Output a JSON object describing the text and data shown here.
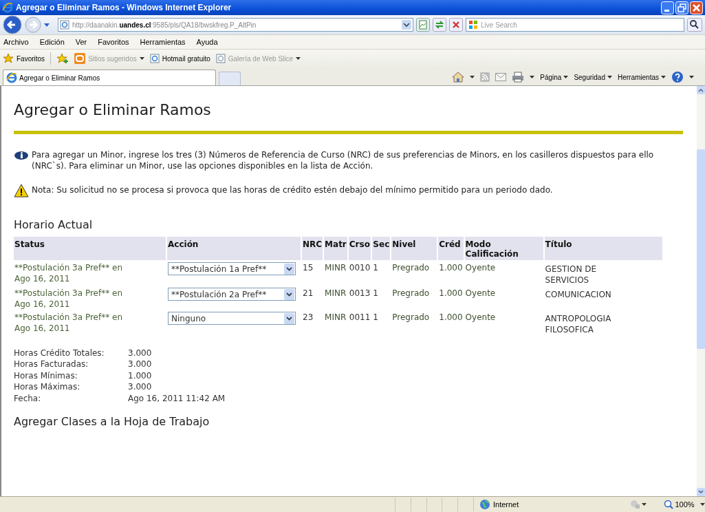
{
  "window": {
    "title": "Agregar o Eliminar Ramos - Windows Internet Explorer"
  },
  "address_bar": {
    "url_prefix": "http://daanakin.",
    "url_domain": "uandes.cl",
    "url_rest": ":9585/pls/QA18/bwskfreg.P_AltPin",
    "search_placeholder": "Live Search"
  },
  "menu": [
    "Archivo",
    "Edición",
    "Ver",
    "Favoritos",
    "Herramientas",
    "Ayuda"
  ],
  "favorites_bar": {
    "label": "Favoritos",
    "items": [
      {
        "label": "Sitios sugeridos",
        "kind": "feed",
        "disabled": true,
        "dropdown": true
      },
      {
        "label": "Hotmail gratuito",
        "kind": "page",
        "disabled": false,
        "dropdown": false
      },
      {
        "label": "Galería de Web Slice",
        "kind": "page",
        "disabled": true,
        "dropdown": true
      }
    ]
  },
  "tab": {
    "title": "Agregar o Eliminar Ramos"
  },
  "command_bar": [
    "Página",
    "Seguridad",
    "Herramientas"
  ],
  "page": {
    "title": "Agregar o Eliminar Ramos",
    "info": "Para agregar un Minor, ingrese los tres (3) Números de Referencia de Curso (NRC) de sus preferencias de Minors, en los casilleros dispuestos para ello (NRC`s). Para eliminar un Minor, use las opciones disponibles en la lista de Acción.",
    "note": "Nota: Su solicitud no se procesa si provoca que las horas de crédito estén debajo del mínimo permitido para un periodo dado.",
    "section": "Horario Actual",
    "table": {
      "columns": [
        "Status",
        "Acción",
        "NRC",
        "Matr",
        "Crso",
        "Sec",
        "Nivel",
        "Créd",
        "Modo Calificación",
        "Título"
      ],
      "rows": [
        {
          "status": "**Postulación 3a Pref** en Ago 16, 2011",
          "action": "**Postulación 1a Pref**",
          "nrc": "15",
          "matr": "MINR",
          "crso": "0010",
          "sec": "1",
          "nivel": "Pregrado",
          "cred": "1.000",
          "modo": "Oyente",
          "titulo": "GESTION DE SERVICIOS"
        },
        {
          "status": "**Postulación 3a Pref** en Ago 16, 2011",
          "action": "**Postulación 2a Pref**",
          "nrc": "21",
          "matr": "MINR",
          "crso": "0013",
          "sec": "1",
          "nivel": "Pregrado",
          "cred": "1.000",
          "modo": "Oyente",
          "titulo": "COMUNICACION"
        },
        {
          "status": "**Postulación 3a Pref** en Ago 16, 2011",
          "action": "Ninguno",
          "nrc": "23",
          "matr": "MINR",
          "crso": "0011",
          "sec": "1",
          "nivel": "Pregrado",
          "cred": "1.000",
          "modo": "Oyente",
          "titulo": "ANTROPOLOGIA FILOSOFICA"
        }
      ]
    },
    "summary": [
      {
        "label": "Horas Crédito Totales:",
        "value": "3.000"
      },
      {
        "label": "Horas Facturadas:",
        "value": "3.000"
      },
      {
        "label": "Horas Mínimas:",
        "value": "1.000"
      },
      {
        "label": "Horas Máximas:",
        "value": "3.000"
      },
      {
        "label": "Fecha:",
        "value": "Ago 16, 2011 11:42 AM"
      }
    ],
    "next_section": "Agregar Clases a la Hoja de Trabajo"
  },
  "status_bar": {
    "zone": "Internet",
    "zoom": "100%"
  }
}
